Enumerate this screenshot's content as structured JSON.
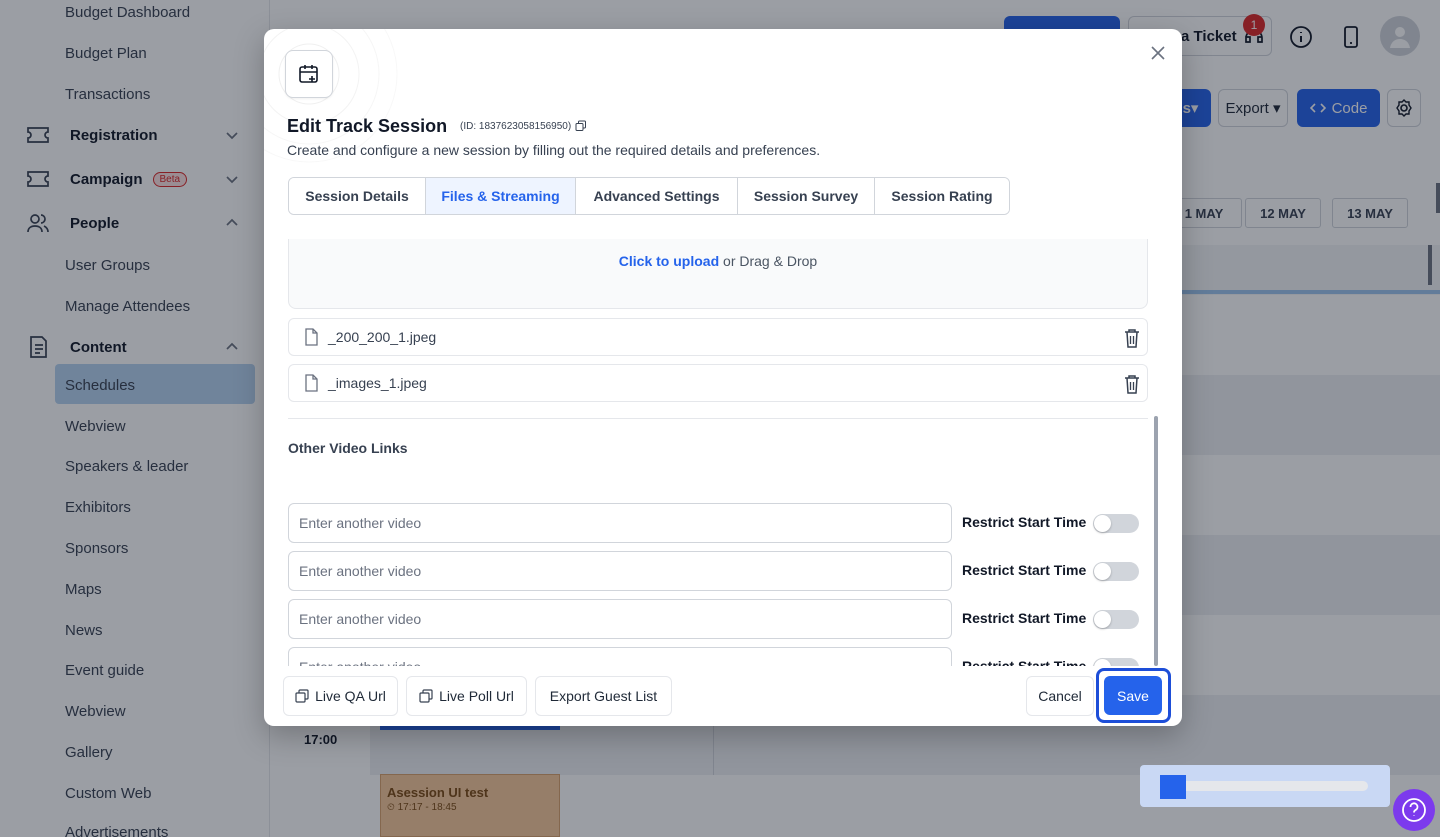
{
  "sidebar": {
    "items": [
      {
        "label": "Budget Dashboard"
      },
      {
        "label": "Budget Plan"
      },
      {
        "label": "Transactions"
      },
      {
        "label": "Registration"
      },
      {
        "label": "Campaign"
      },
      {
        "label": "People"
      },
      {
        "label": "User Groups"
      },
      {
        "label": "Manage Attendees"
      },
      {
        "label": "Content"
      },
      {
        "label": "Schedules"
      },
      {
        "label": "Webview"
      },
      {
        "label": "Speakers & leader"
      },
      {
        "label": "Exhibitors"
      },
      {
        "label": "Sponsors"
      },
      {
        "label": "Maps"
      },
      {
        "label": "News"
      },
      {
        "label": "Event guide"
      },
      {
        "label": "Webview"
      },
      {
        "label": "Gallery"
      },
      {
        "label": "Custom Web"
      },
      {
        "label": "Advertisements"
      }
    ],
    "campaign_badge": "Beta"
  },
  "topbar": {
    "ticket_label": "a Ticket",
    "notification_count": "1",
    "export_label": "Export",
    "code_label": "Code",
    "partial_label": "s"
  },
  "calendar": {
    "days": [
      "1 MAY",
      "12 MAY",
      "13 MAY"
    ],
    "time": "17:00",
    "session_title": "Asession UI test",
    "session_time": "17:17 - 18:45"
  },
  "modal": {
    "title": "Edit Track Session",
    "id_text": "(ID: 1837623058156950)",
    "subtitle": "Create and configure a new session by filling out the required details and preferences.",
    "tabs": [
      {
        "label": "Session Details"
      },
      {
        "label": "Files & Streaming"
      },
      {
        "label": "Advanced Settings"
      },
      {
        "label": "Session Survey"
      },
      {
        "label": "Session Rating"
      }
    ],
    "upload": {
      "link": "Click to upload",
      "rest": " or Drag & Drop"
    },
    "files": [
      {
        "name": "_200_200_1.jpeg"
      },
      {
        "name": "_images_1.jpeg"
      }
    ],
    "other_video_label": "Other Video Links",
    "videos": [
      {
        "placeholder": "Enter another video",
        "value": "",
        "restrict_label": "Restrict Start Time",
        "restrict_on": false
      },
      {
        "placeholder": "Enter another video",
        "value": "",
        "restrict_label": "Restrict Start Time",
        "restrict_on": false
      },
      {
        "placeholder": "Enter another video",
        "value": "",
        "restrict_label": "Restrict Start Time",
        "restrict_on": false
      },
      {
        "placeholder": "Enter another video",
        "value": "",
        "restrict_label": "Restrict Start Time",
        "restrict_on": false
      }
    ],
    "footer": {
      "live_qa": "Live QA Url",
      "live_poll": "Live Poll Url",
      "export_guest": "Export Guest List",
      "cancel": "Cancel",
      "save": "Save"
    }
  },
  "colors": {
    "primary": "#2563eb",
    "active_tab_bg": "#eef4ff",
    "sidebar_active": "#b6d2ef",
    "overlay": "rgba(17,24,39,0.42)"
  }
}
